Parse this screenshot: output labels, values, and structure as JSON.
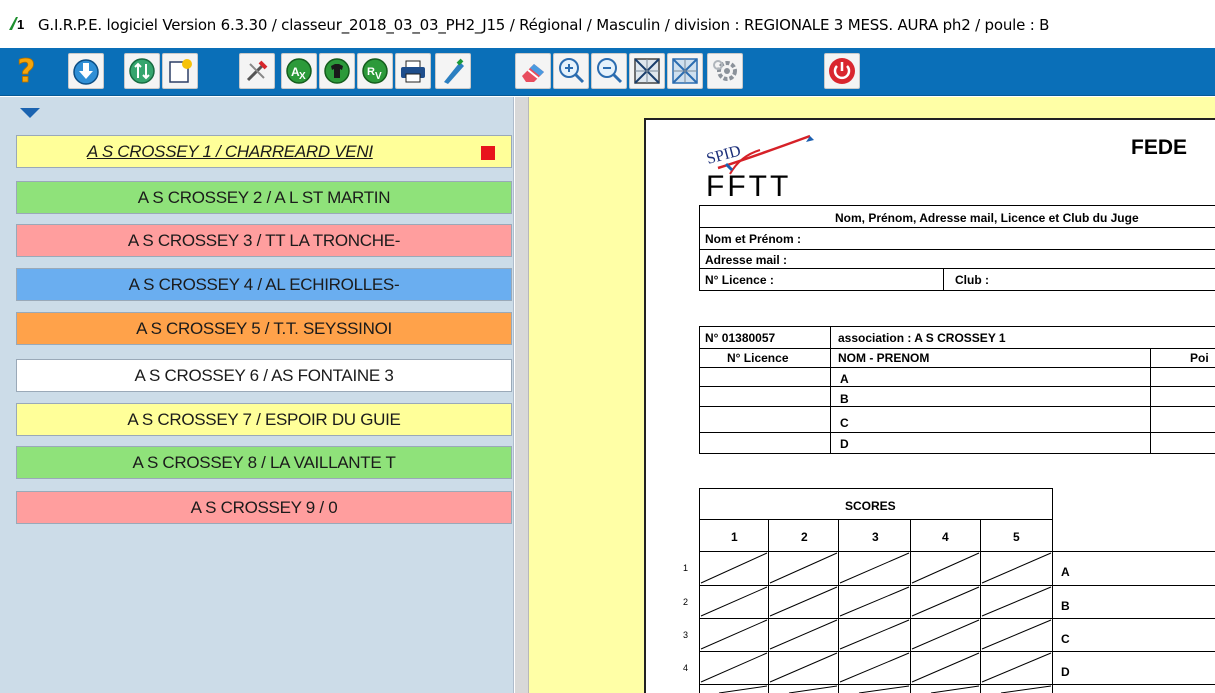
{
  "titlebar": {
    "app_badge": "1",
    "title": "G.I.R.P.E.  logiciel Version 6.3.30  /  classeur_2018_03_03_PH2_J15  /  Régional  /  Masculin  /  division : REGIONALE 3 MESS. AURA ph2  /  poule : B"
  },
  "toolbar": {
    "buttons": [
      {
        "icon": "help-icon"
      },
      {
        "icon": "download-icon"
      },
      {
        "icon": "sort-icon"
      },
      {
        "icon": "new-document-icon"
      },
      {
        "icon": "tools-icon"
      },
      {
        "icon": "ax-icon"
      },
      {
        "icon": "jersey-icon"
      },
      {
        "icon": "rv-icon"
      },
      {
        "icon": "print-icon"
      },
      {
        "icon": "pen-icon"
      },
      {
        "icon": "eraser-icon"
      },
      {
        "icon": "zoom-in-icon"
      },
      {
        "icon": "zoom-out-icon"
      },
      {
        "icon": "grid-x-icon"
      },
      {
        "icon": "grid-x-alt-icon"
      },
      {
        "icon": "settings-icon"
      },
      {
        "icon": "power-icon"
      }
    ],
    "colors": {
      "bar": "#0a6fb8"
    }
  },
  "teams": [
    {
      "label": "A S CROSSEY 1 / CHARREARD VENI",
      "color": "#ffff99",
      "selected": true
    },
    {
      "label": "A S CROSSEY 2 / A L ST MARTIN",
      "color": "#8fe27a"
    },
    {
      "label": "A S CROSSEY 3 / TT LA TRONCHE-",
      "color": "#ff9e9e"
    },
    {
      "label": "A S CROSSEY 4 / AL ECHIROLLES-",
      "color": "#6aaef0"
    },
    {
      "label": "A S CROSSEY 5 / T.T. SEYSSINOI",
      "color": "#ffa24a"
    },
    {
      "label": "A S CROSSEY 6 / AS FONTAINE 3",
      "color": "#ffffff"
    },
    {
      "label": "A S CROSSEY 7 / ESPOIR DU GUIE",
      "color": "#ffff99"
    },
    {
      "label": "A S CROSSEY 8 / LA VAILLANTE T",
      "color": "#8fe27a"
    },
    {
      "label": "A S CROSSEY 9 /  0",
      "color": "#ff9e9e"
    }
  ],
  "sheet": {
    "logo_top": "SPID",
    "logo_bottom": "FFTT",
    "fed_title": "FEDE",
    "judge_header": "Nom, Prénom, Adresse mail, Licence et Club du Juge",
    "nom_prenom": "Nom et Prénom :",
    "adresse": "Adresse mail  :",
    "licence": "N° Licence    :",
    "club": "Club :",
    "assoc_num": "N° 01380057",
    "assoc_name": "association : A S CROSSEY 1",
    "col_licence": "N° Licence",
    "col_nom": "NOM - PRENOM",
    "col_points": "Poi",
    "players": [
      "A",
      "B",
      "C",
      "D"
    ],
    "scores_title": "SCORES",
    "score_cols": [
      "1",
      "2",
      "3",
      "4",
      "5"
    ],
    "row_nums": [
      "1",
      "2",
      "3",
      "4"
    ],
    "row_letters": [
      "A",
      "B",
      "C",
      "D"
    ]
  }
}
